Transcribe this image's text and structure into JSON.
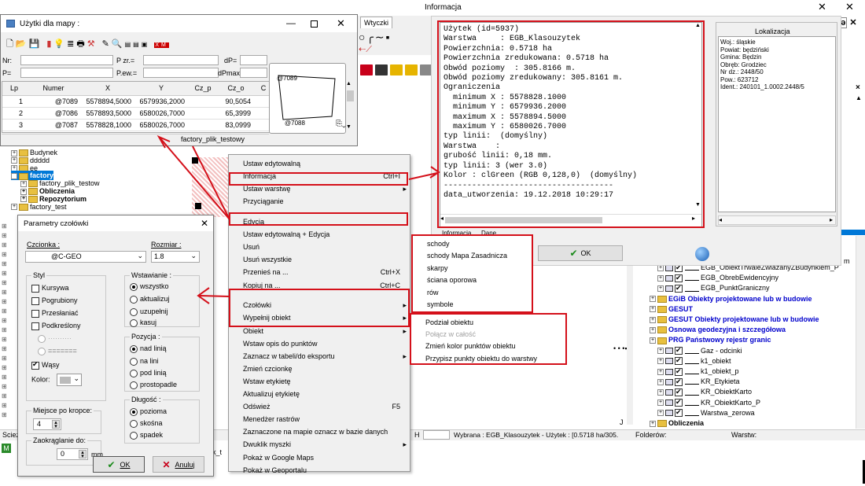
{
  "info_window": {
    "title": "Informacja",
    "lines": [
      "Użytek (id=5937)",
      "Warstwa     : EGB_Klasouzytek",
      "Powierzchnia: 0.5718 ha",
      "Powierzchnia zredukowana: 0.5718 ha",
      "Obwód poziomy  : 305.8166 m.",
      "Obwód poziomy zredukowany: 305.8161 m.",
      "Ograniczenia",
      "  minimum X : 5578828.1000",
      "  minimum Y : 6579936.2000",
      "  maximum X : 5578894.5000",
      "  maximum Y : 6580026.7000",
      "typ linii:  (domyślny)",
      "Warstwa    :",
      "grubość linii: 0,18 mm.",
      "typ linii: 3 (wer 3.0)",
      "Kolor : clGreen (RGB 0,128,0)  (domyślny)",
      "------------------------------------",
      "data_utworzenia: 19.12.2018 10:29:17"
    ],
    "tabs": [
      "Informacja",
      "Dane"
    ],
    "ok_label": "OK",
    "lokalizacja_title": "Lokalizacja",
    "lokalizacja_lines": [
      "Woj.: śląskie",
      "Powiat: będziński",
      "Gmina: Będzin",
      "Obręb: Grodziec",
      "Nr dz.: 2448/50",
      "Pow.: 623712",
      "Ident.: 240101_1.0002.2448/5"
    ]
  },
  "uzytki_window": {
    "title": "Użytki dla mapy :",
    "labels": {
      "nr": "Nr:",
      "p": "P=",
      "pzr": "P zr.=",
      "pew": "P.ew.=",
      "dp": "dP=",
      "dpmax": "dPmax="
    },
    "columns": [
      "Lp",
      "Numer",
      "X",
      "Y",
      "Cz_p",
      "Cz_o",
      "C"
    ],
    "rows": [
      {
        "lp": "1",
        "numer": "@7089",
        "x": "5578894,5000",
        "y": "6579936,2000",
        "czp": "",
        "czo": "90,5054"
      },
      {
        "lp": "2",
        "numer": "@7086",
        "x": "5578893,5000",
        "y": "6580026,7000",
        "czp": "",
        "czo": "65,3999"
      },
      {
        "lp": "3",
        "numer": "@7087",
        "x": "5578828,1000",
        "y": "6580026,7000",
        "czp": "",
        "czo": "83,0999"
      }
    ],
    "preview_labels": [
      "@7089",
      "@7088"
    ],
    "status": "factory_plik_testowy"
  },
  "wtyczki_tab": "Wtyczki",
  "tree_left": {
    "items": [
      {
        "label": "Budynek",
        "indent": 1
      },
      {
        "label": "ddddd",
        "indent": 1
      },
      {
        "label": "ee",
        "indent": 1
      },
      {
        "label": "factory",
        "indent": 1
      },
      {
        "label": "factory_plik_testow",
        "indent": 2
      },
      {
        "label": "Obliczenia",
        "indent": 2
      },
      {
        "label": "Repozytorium",
        "indent": 2
      },
      {
        "label": "factory_test",
        "indent": 1
      }
    ]
  },
  "context_menu": {
    "items": [
      {
        "label": "Ustaw edytowalną",
        "shortcut": "",
        "arrow": false,
        "disabled": false
      },
      {
        "label": "Informacja",
        "shortcut": "Ctrl+I",
        "arrow": false,
        "disabled": false
      },
      {
        "label": "Ustaw warstwę",
        "shortcut": "",
        "arrow": true,
        "disabled": false
      },
      {
        "label": "Przyciąganie",
        "shortcut": "",
        "arrow": false,
        "disabled": false
      },
      {
        "label": "Edycja",
        "shortcut": "",
        "arrow": false,
        "disabled": false
      },
      {
        "label": "Ustaw edytowalną + Edycja",
        "shortcut": "",
        "arrow": false,
        "disabled": false
      },
      {
        "label": "Usuń",
        "shortcut": "",
        "arrow": false,
        "disabled": false
      },
      {
        "label": "Usuń wszystkie",
        "shortcut": "",
        "arrow": false,
        "disabled": false
      },
      {
        "label": "Przenieś na ...",
        "shortcut": "Ctrl+X",
        "arrow": false,
        "disabled": false
      },
      {
        "label": "Kopiuj na ...",
        "shortcut": "Ctrl+C",
        "arrow": false,
        "disabled": false
      },
      {
        "label": "Czołówki",
        "shortcut": "",
        "arrow": true,
        "disabled": false
      },
      {
        "label": "Wypełnij obiekt",
        "shortcut": "",
        "arrow": true,
        "disabled": false
      },
      {
        "label": "Obiekt",
        "shortcut": "",
        "arrow": true,
        "disabled": false
      },
      {
        "label": "Wstaw opis do punktów",
        "shortcut": "",
        "arrow": false,
        "disabled": false
      },
      {
        "label": "Zaznacz w tabeli/do eksportu",
        "shortcut": "",
        "arrow": true,
        "disabled": false
      },
      {
        "label": "Zmień czcionkę",
        "shortcut": "",
        "arrow": false,
        "disabled": false
      },
      {
        "label": "Wstaw etykietę",
        "shortcut": "",
        "arrow": false,
        "disabled": false
      },
      {
        "label": "Aktualizuj etykietę",
        "shortcut": "",
        "arrow": false,
        "disabled": false
      },
      {
        "label": "Odśwież",
        "shortcut": "F5",
        "arrow": false,
        "disabled": false
      },
      {
        "label": "Menedżer rastrów",
        "shortcut": "",
        "arrow": false,
        "disabled": false
      },
      {
        "label": "Zaznaczone na mapie oznacz w bazie danych",
        "shortcut": "",
        "arrow": false,
        "disabled": false
      },
      {
        "label": "Dwuklik myszki",
        "shortcut": "",
        "arrow": true,
        "disabled": false
      },
      {
        "label": "Pokaż w Google Maps",
        "shortcut": "",
        "arrow": false,
        "disabled": false
      },
      {
        "label": "Pokaż w Geoportalu",
        "shortcut": "",
        "arrow": false,
        "disabled": false
      }
    ]
  },
  "submenu_fill": {
    "items": [
      "schody",
      "schody Mapa Zasadnicza",
      "skarpy",
      "ściana oporowa",
      "rów",
      "symbole"
    ]
  },
  "submenu_obiekt": {
    "items": [
      {
        "label": "Podział obiektu",
        "disabled": false
      },
      {
        "label": "Połącz w całość",
        "disabled": true
      },
      {
        "label": "Zmień kolor punktów obiektu",
        "disabled": false
      },
      {
        "label": "Przypisz punkty obiektu do warstwy",
        "disabled": false
      }
    ]
  },
  "params_dialog": {
    "title": "Parametry czołówki",
    "czcionka_label": "Czcionka :",
    "czcionka_value": "@C-GEO",
    "rozmiar_label": "Rozmiar :",
    "rozmiar_value": "1.8",
    "styl_label": "Styl",
    "styl_options": [
      "Kursywa",
      "Pogrubiony",
      "Przesłaniać",
      "Podkreślony"
    ],
    "wasy_label": "Wąsy",
    "kolor_label": "Kolor:",
    "wstawianie_label": "Wstawianie :",
    "wstawianie_options": [
      "wszystko",
      "aktualizuj",
      "uzupełnij",
      "kasuj"
    ],
    "pozycja_label": "Pozycja :",
    "pozycja_options": [
      "nad linią",
      "na lini",
      "pod linią",
      "prostopadle"
    ],
    "dlugosc_label": "Długość :",
    "dlugosc_options": [
      "pozioma",
      "skośna",
      "spadek"
    ],
    "miejsce_label": "Miejsce po kropce:",
    "miejsce_value": "4",
    "zaokr_label": "Zaokrąglanie do:",
    "zaokr_value": "0",
    "zaokr_unit": "mm",
    "ok_label": "OK",
    "cancel_label": "Anuluj"
  },
  "tree_right": {
    "items": [
      {
        "label": "EGB_ObiektTrwaleZwiazanyZBudynkiem_P",
        "type": "layer"
      },
      {
        "label": "EGB_ObrebEwidencyjny",
        "type": "layer"
      },
      {
        "label": "EGB_PunktGraniczny",
        "type": "layer"
      },
      {
        "label": "EGiB Obiekty projektowane lub w budowie",
        "type": "folder"
      },
      {
        "label": "GESUT",
        "type": "folder"
      },
      {
        "label": "GESUT Obiekty projektowane lub w budowie",
        "type": "folder"
      },
      {
        "label": "Osnowa geodezyjna i szczegółowa",
        "type": "folder"
      },
      {
        "label": "PRG Państwowy rejestr granic",
        "type": "folder"
      },
      {
        "label": "Gaz - odcinki",
        "type": "layer"
      },
      {
        "label": "k1_obiekt",
        "type": "layer"
      },
      {
        "label": "k1_obiekt_p",
        "type": "layer"
      },
      {
        "label": "KR_Etykieta",
        "type": "layer"
      },
      {
        "label": "KR_ObiektKarto",
        "type": "layer"
      },
      {
        "label": "KR_ObiektKarto_P",
        "type": "layer"
      },
      {
        "label": "Warstwa_zerowa",
        "type": "layer"
      },
      {
        "label": "Obliczenia",
        "type": "db"
      }
    ],
    "partial_top": "m"
  },
  "status_bar": {
    "left": "Scieżk",
    "h": "H",
    "wybrana": "Wybrana : EGB_Klasouzytek - Użytek : [0.5718 ha/305.",
    "folderow": "Folderów:",
    "warstw": "Warstw:"
  },
  "colors": {
    "highlight": "#d4101a",
    "selection": "#0078d7",
    "folder": "#e8c040",
    "tree_blue": "#0000cc"
  }
}
